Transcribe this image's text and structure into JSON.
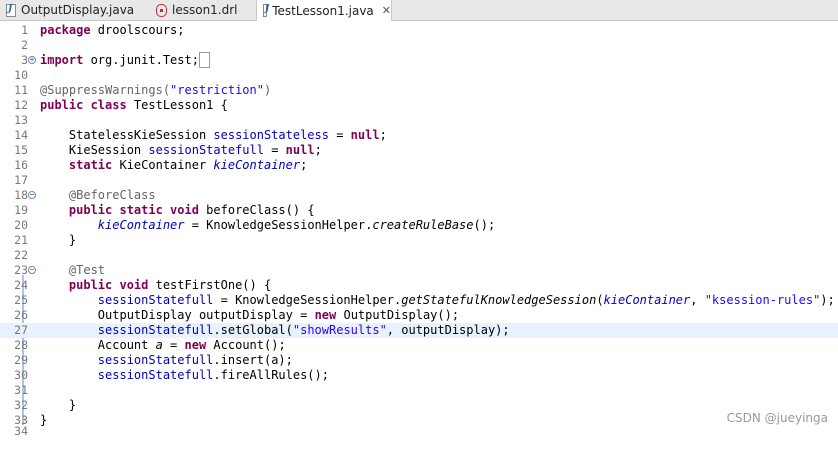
{
  "tabs": [
    {
      "label": "OutputDisplay.java",
      "active": false,
      "icon": "java-file-icon"
    },
    {
      "label": "lesson1.drl",
      "active": false,
      "icon": "drl-file-icon"
    },
    {
      "label": "TestLesson1.java",
      "active": true,
      "icon": "java-file-icon",
      "close": "✕"
    }
  ],
  "lines": {
    "1": "1",
    "2": "2",
    "3": "3",
    "10": "10",
    "11": "11",
    "12": "12",
    "13": "13",
    "14": "14",
    "15": "15",
    "16": "16",
    "17": "17",
    "18": "18",
    "19": "19",
    "20": "20",
    "21": "21",
    "22": "22",
    "23": "23",
    "24": "24",
    "25": "25",
    "26": "26",
    "27": "27",
    "28": "28",
    "29": "29",
    "30": "30",
    "31": "31",
    "32": "32",
    "33": "33",
    "34": "34"
  },
  "code": {
    "package_kw": "package",
    "package_name": " droolscours;",
    "import_kw": "import",
    "import_name": " org.junit.Test;",
    "suppress": "@SuppressWarnings(",
    "suppress_str": "\"restriction\"",
    "suppress_end": ")",
    "class_kw": "public class",
    "class_name": " TestLesson1 {",
    "l14_type": "    StatelessKieSession ",
    "l14_field": "sessionStateless",
    "l14_eq": " = ",
    "l14_null": "null",
    "l14_end": ";",
    "l15_type": "    KieSession ",
    "l15_field": "sessionStatefull",
    "l15_eq": " = ",
    "l15_null": "null",
    "l15_end": ";",
    "l16_kw": "    static",
    "l16_type": " KieContainer ",
    "l16_field": "kieContainer",
    "l16_end": ";",
    "l18_ann": "    @BeforeClass",
    "l19_kw": "    public static void",
    "l19_rest": " beforeClass() {",
    "l20_field": "        kieContainer",
    "l20_mid": " = KnowledgeSessionHelper.",
    "l20_method": "createRuleBase",
    "l20_end": "();",
    "l21": "    }",
    "l23_ann": "    @Test",
    "l24_kw": "    public void",
    "l24_rest": " testFirstOne() {",
    "l25_field": "        sessionStatefull",
    "l25_mid": " = KnowledgeSessionHelper.",
    "l25_method": "getStatefulKnowledgeSession",
    "l25_open": "(",
    "l25_arg": "kieContainer",
    "l25_sep": ", ",
    "l25_str": "\"ksession-rules\"",
    "l25_end": ");",
    "l26_type": "        OutputDisplay ",
    "l26_var": "outputDisplay",
    "l26_eq": " = ",
    "l26_new": "new",
    "l26_end": " OutputDisplay();",
    "l27_field": "        sessionStatefull",
    "l27_mid": ".setGlobal(",
    "l27_str": "\"showResults\"",
    "l27_end": ", outputDisplay);",
    "l28_type": "        Account ",
    "l28_var": "a",
    "l28_eq": " = ",
    "l28_new": "new",
    "l28_end": " Account();",
    "l29_field": "        sessionStatefull",
    "l29_end": ".insert(a);",
    "l30_field": "        sessionStatefull",
    "l30_end": ".fireAllRules();",
    "l32": "    }",
    "l33": "}"
  },
  "watermark": "CSDN @jueyinga"
}
